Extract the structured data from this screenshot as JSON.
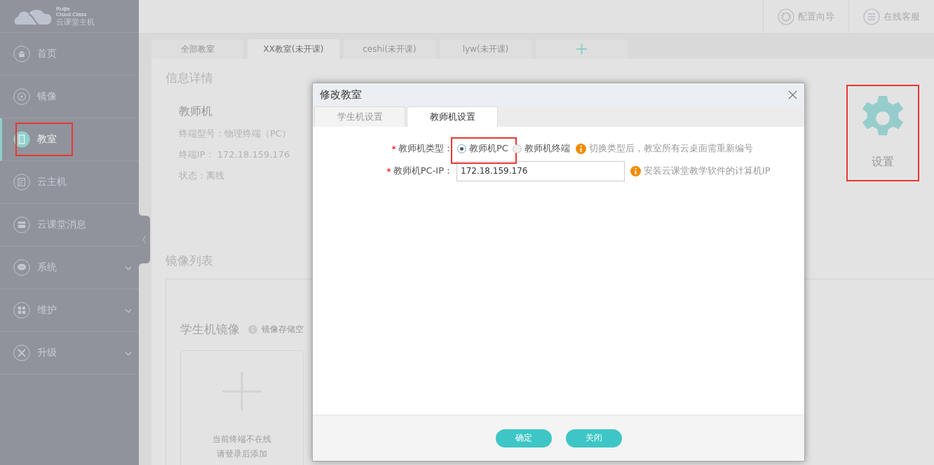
{
  "logo": {
    "line_1": "Ruijie",
    "line_2": "Cloud Class",
    "name": "云课堂主机"
  },
  "sidebar": {
    "items": [
      {
        "label": "首页",
        "selected": false,
        "expandable": false,
        "highlighted": false
      },
      {
        "label": "镜像",
        "selected": false,
        "expandable": false,
        "highlighted": false
      },
      {
        "label": "教室",
        "selected": true,
        "expandable": false,
        "highlighted": true
      },
      {
        "label": "云主机",
        "selected": false,
        "expandable": false,
        "highlighted": false
      },
      {
        "label": "云课堂消息",
        "selected": false,
        "expandable": false,
        "highlighted": false
      },
      {
        "label": "系统",
        "selected": false,
        "expandable": true,
        "highlighted": false
      },
      {
        "label": "维护",
        "selected": false,
        "expandable": true,
        "highlighted": false
      },
      {
        "label": "升级",
        "selected": false,
        "expandable": true,
        "highlighted": false
      }
    ]
  },
  "topbar": {
    "buttons": [
      {
        "label": "配置向导"
      },
      {
        "label": "在线客服"
      }
    ]
  },
  "tabs": [
    {
      "label": "全部教室",
      "kind": "text",
      "selected": false
    },
    {
      "label": "XX教室(未开课)",
      "kind": "text",
      "selected": true
    },
    {
      "label": "ceshi(未开课)",
      "kind": "text",
      "selected": false
    },
    {
      "label": "lyw(未开课)",
      "kind": "text",
      "selected": false
    },
    {
      "label": "+",
      "kind": "add"
    }
  ],
  "detail": {
    "heading": "信息详情",
    "title": "教师机",
    "lines": [
      "终端型号：物理终端（PC）",
      "终端IP： 172.18.159.176",
      "状态：离线"
    ]
  },
  "settings": {
    "label": "设置",
    "highlighted": true
  },
  "images": {
    "heading": "镜像列表",
    "section_title": "学生机镜像",
    "note": "镜像存储空",
    "card_lines": [
      "当前终端不在线",
      "请登录后添加"
    ]
  },
  "dialog": {
    "title": "修改教室",
    "tabs": [
      {
        "label": "学生机设置",
        "selected": false
      },
      {
        "label": "教师机设置",
        "selected": true
      }
    ],
    "fields": [
      {
        "kind": "radio",
        "label": "教师机类型：",
        "marker": "*",
        "options": [
          {
            "label": "教师机PC",
            "selected": true,
            "highlighted": true
          },
          {
            "label": "教师机终端",
            "selected": false,
            "highlighted": false
          }
        ],
        "hint": "切换类型后，教室所有云桌面需重新编号"
      },
      {
        "kind": "text",
        "label": "教师机PC-IP：",
        "marker": "*",
        "value": "172.18.159.176",
        "hint": "安装云课堂教学软件的计算机IP"
      }
    ],
    "buttons": [
      "确定",
      "关闭"
    ]
  }
}
